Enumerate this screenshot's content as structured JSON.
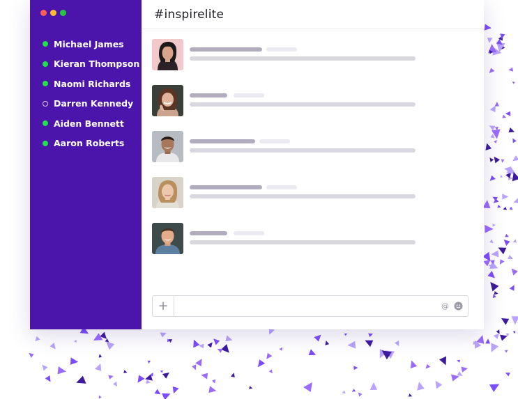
{
  "window": {
    "traffic_lights": [
      "#ff5f57",
      "#febc2e",
      "#28c840"
    ]
  },
  "sidebar": {
    "background": "#4b14aa",
    "users": [
      {
        "name": "Michael James",
        "status": "online"
      },
      {
        "name": "Kieran Thompson",
        "status": "online"
      },
      {
        "name": "Naomi Richards",
        "status": "online"
      },
      {
        "name": "Darren Kennedy",
        "status": "offline"
      },
      {
        "name": "Aiden Bennett",
        "status": "online"
      },
      {
        "name": "Aaron Roberts",
        "status": "online"
      }
    ]
  },
  "header": {
    "channel": "#inspirelite"
  },
  "messages": [
    {
      "avatar": "avatar-woman-dark-hair"
    },
    {
      "avatar": "avatar-woman-smiling"
    },
    {
      "avatar": "avatar-man-smiling"
    },
    {
      "avatar": "avatar-woman-blonde"
    },
    {
      "avatar": "avatar-man-short-hair"
    }
  ],
  "composer": {
    "add_icon": "plus-icon",
    "mention_icon": "at-icon",
    "emoji_icon": "smiley-icon",
    "placeholder": ""
  },
  "colors": {
    "accent": "#4b14aa",
    "confetti": [
      "#7c4dff",
      "#3d1a9e",
      "#b9a3ff",
      "#9b6bff"
    ],
    "online": "#22e04b"
  }
}
